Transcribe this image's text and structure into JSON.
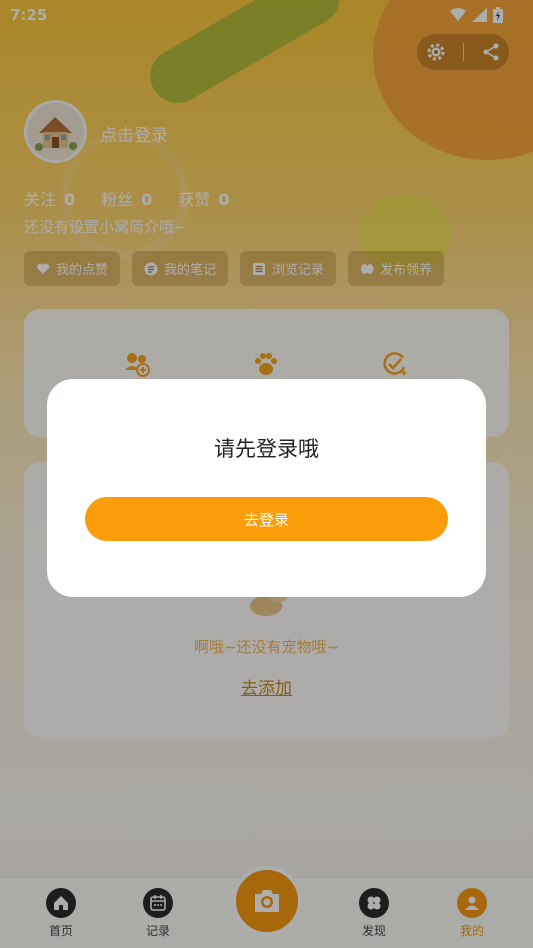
{
  "status_bar": {
    "time": "7:25"
  },
  "profile": {
    "login_prompt": "点击登录",
    "bio": "还没有设置小窝简介哦~"
  },
  "stats": [
    {
      "label": "关注",
      "value": "0"
    },
    {
      "label": "粉丝",
      "value": "0"
    },
    {
      "label": "获赞",
      "value": "0"
    }
  ],
  "chips": [
    {
      "label": "我的点赞",
      "icon": "heart-icon"
    },
    {
      "label": "我的笔记",
      "icon": "note-icon"
    },
    {
      "label": "浏览记录",
      "icon": "history-icon"
    },
    {
      "label": "发布领养",
      "icon": "adopt-icon"
    }
  ],
  "pets": {
    "empty_text": "啊哦~还没有宠物哦~",
    "add_link": "去添加"
  },
  "tabbar": {
    "tabs": [
      {
        "label": "首页",
        "icon": "home-icon"
      },
      {
        "label": "记录",
        "icon": "calendar-icon"
      },
      {
        "label": "发现",
        "icon": "discover-icon"
      },
      {
        "label": "我的",
        "icon": "profile-icon"
      }
    ],
    "camera_icon": "camera-icon"
  },
  "dialog": {
    "title": "请先登录哦",
    "button": "去登录"
  },
  "colors": {
    "accent": "#f99d0a",
    "tab_active": "#f59a10"
  }
}
